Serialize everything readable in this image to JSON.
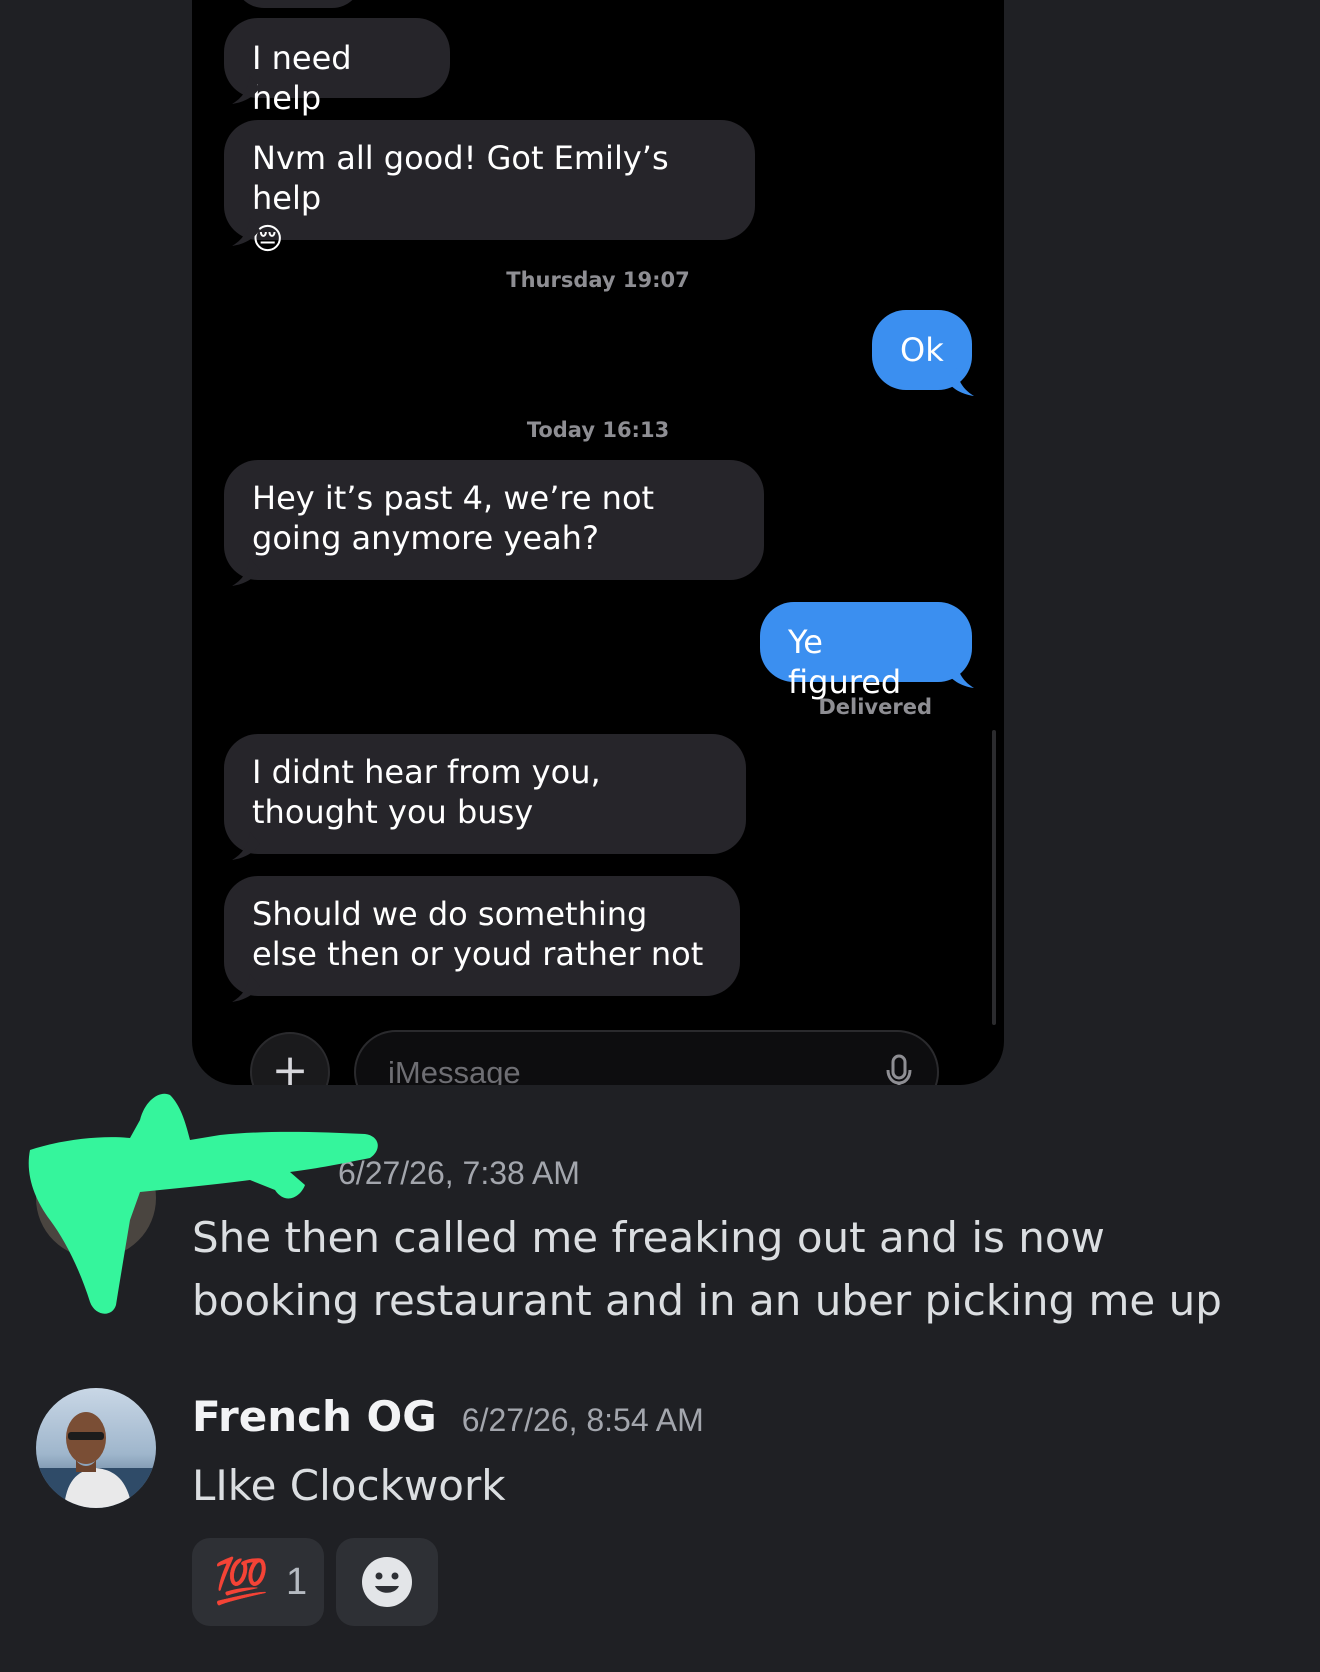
{
  "imessage": {
    "messages": [
      {
        "side": "in",
        "text": "I need help"
      },
      {
        "side": "in",
        "text": "Nvm all good! Got Emily’s help 😔"
      },
      {
        "side": "meta",
        "text": "Thursday 19:07"
      },
      {
        "side": "out",
        "text": "Ok"
      },
      {
        "side": "meta",
        "text": "Today 16:13"
      },
      {
        "side": "in",
        "text": "Hey it’s past 4, we’re not going anymore yeah?"
      },
      {
        "side": "out",
        "text": "Ye figured"
      },
      {
        "side": "status",
        "text": "Delivered"
      },
      {
        "side": "in",
        "text": "I didnt hear from you, thought you busy"
      },
      {
        "side": "in",
        "text": "Should we do something else then or youd rather not"
      }
    ],
    "input_placeholder": "iMessage",
    "plus_label": "+",
    "emoji_label": "😔"
  },
  "discord": {
    "first_message": {
      "timestamp": "6/27/26, 7:38 AM",
      "text": "She then called me freaking out and is now booking restaurant and in an uber picking me up"
    },
    "second_message": {
      "username": "French OG",
      "timestamp": "6/27/26, 8:54 AM",
      "text": "LIke Clockwork"
    },
    "reactions": [
      {
        "emoji": "💯",
        "count": "1"
      }
    ],
    "colors": {
      "background": "#1f2024",
      "incoming_bubble": "#26252a",
      "outgoing_bubble": "#3b8ff0",
      "redaction": "#35f59c"
    }
  }
}
